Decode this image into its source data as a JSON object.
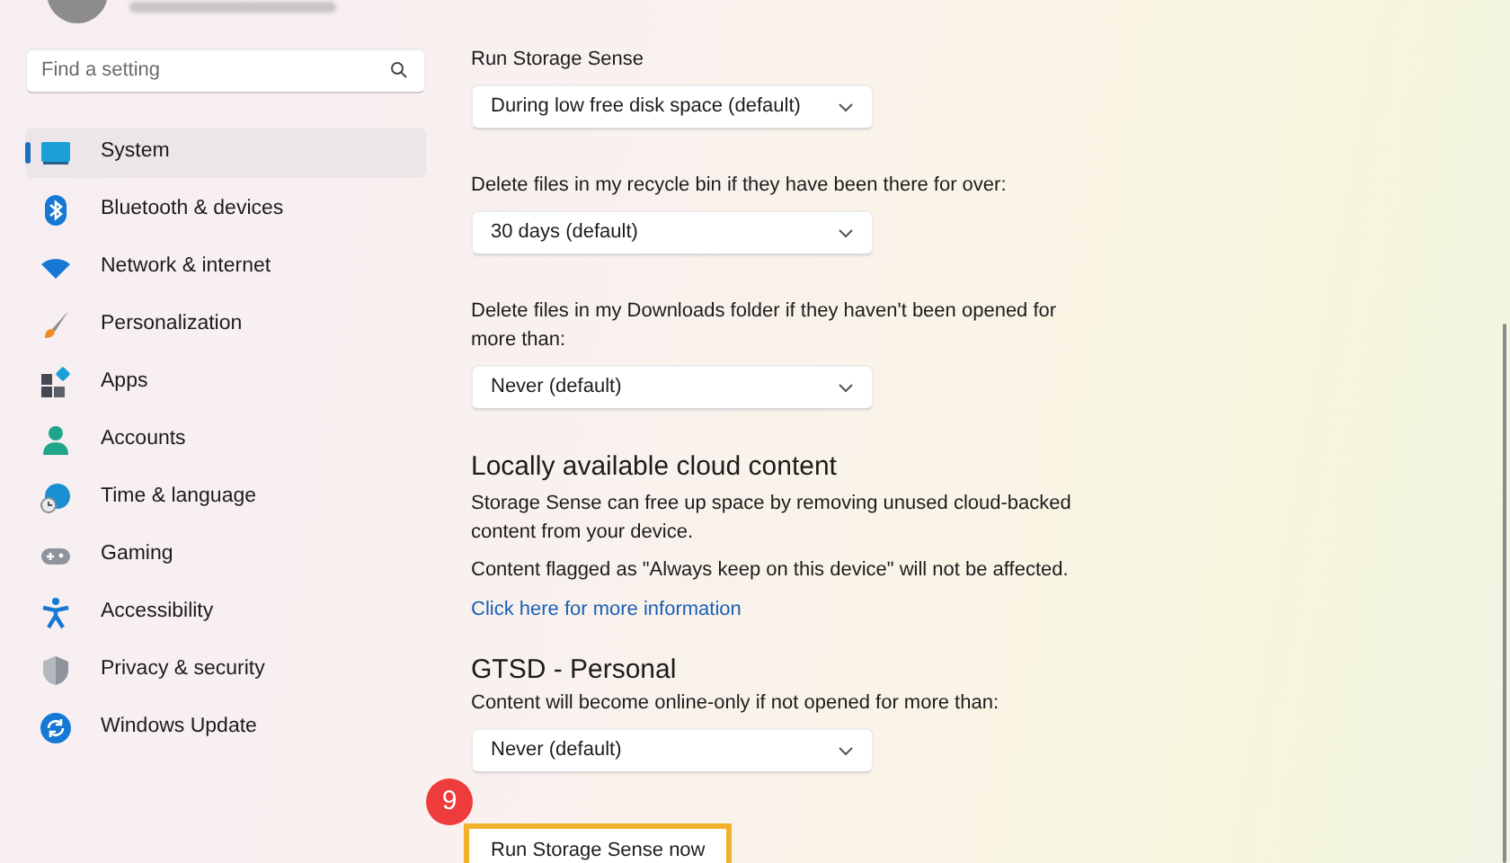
{
  "sidebar": {
    "search": {
      "placeholder": "Find a setting"
    },
    "items": [
      {
        "label": "System",
        "selected": true
      },
      {
        "label": "Bluetooth & devices",
        "selected": false
      },
      {
        "label": "Network & internet",
        "selected": false
      },
      {
        "label": "Personalization",
        "selected": false
      },
      {
        "label": "Apps",
        "selected": false
      },
      {
        "label": "Accounts",
        "selected": false
      },
      {
        "label": "Time & language",
        "selected": false
      },
      {
        "label": "Gaming",
        "selected": false
      },
      {
        "label": "Accessibility",
        "selected": false
      },
      {
        "label": "Privacy & security",
        "selected": false
      },
      {
        "label": "Windows Update",
        "selected": false
      }
    ]
  },
  "content": {
    "settings": [
      {
        "label": "Run Storage Sense",
        "value": "During low free disk space (default)"
      },
      {
        "label": "Delete files in my recycle bin if they have been there for over:",
        "value": "30 days (default)"
      },
      {
        "label": "Delete files in my Downloads folder if they haven't been opened for more than:",
        "value": "Never (default)"
      }
    ],
    "cloud": {
      "heading": "Locally available cloud content",
      "description": "Storage Sense can free up space by removing unused cloud-backed content from your device.",
      "note": "Content flagged as \"Always keep on this device\" will not be affected.",
      "link": "Click here for more information"
    },
    "account": {
      "heading": "GTSD - Personal",
      "label": "Content will become online-only if not opened for more than:",
      "value": "Never (default)"
    },
    "step_badge": "9",
    "run_button": "Run Storage Sense now"
  }
}
